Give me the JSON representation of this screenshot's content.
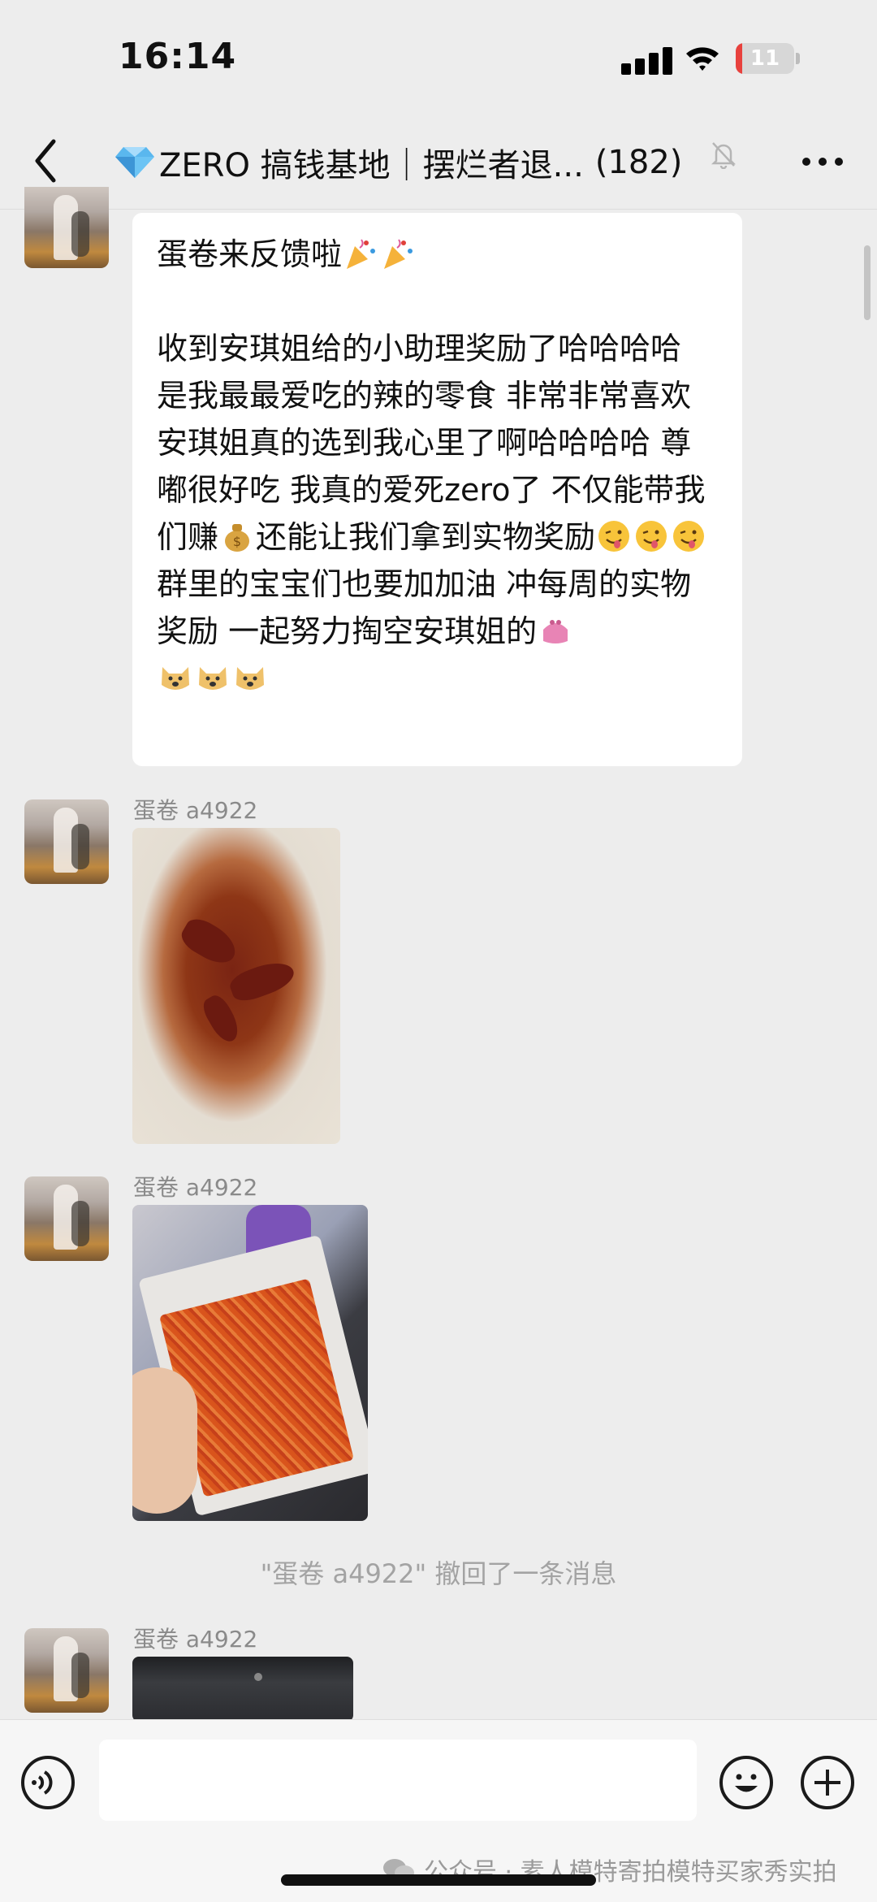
{
  "status_bar": {
    "time": "16:14",
    "battery_level": "11",
    "battery_fraction": 0.11
  },
  "header": {
    "title": "ZERO 搞钱基地｜摆烂者退...",
    "member_count": "(182)",
    "icons": [
      "back-chevron-icon",
      "diamond-icon",
      "muted-bell-icon",
      "more-dots-icon"
    ]
  },
  "messages": [
    {
      "type": "text",
      "lines": [
        "蛋卷来反馈啦",
        "",
        "收到安琪姐给的小助理奖励了哈哈哈哈  是我最最爱吃的辣的零食 非常非常喜欢  安琪姐真的选到我心里了啊哈哈哈哈 尊嘟很好吃 我真的爱死zero了 不仅能带我们赚",
        "还能让我们拿到实物奖励",
        "群里的宝宝们也要加加油 冲每周的实物奖励 一起努力掏空安琪姐的"
      ],
      "emojis": [
        "party-popper",
        "party-popper",
        "money-bag",
        "winking-tongue-face",
        "winking-tongue-face",
        "winking-tongue-face",
        "purse",
        "doge-face",
        "doge-face",
        "doge-face"
      ]
    },
    {
      "type": "image",
      "sender": "蛋卷 a4922",
      "subject": "spicy-snack-in-bowl"
    },
    {
      "type": "image",
      "sender": "蛋卷 a4922",
      "subject": "spicy-snack-package"
    },
    {
      "type": "system",
      "text": "\"蛋卷 a4922\" 撤回了一条消息"
    },
    {
      "type": "image",
      "sender": "蛋卷 a4922",
      "subject": "dark-screen-photo"
    }
  ],
  "input_bar": {
    "value": "",
    "icons": [
      "voice-icon",
      "emoji-icon",
      "plus-icon"
    ]
  },
  "watermark": "公众号 · 素人模特寄拍模特买家秀实拍",
  "colors": {
    "background": "#ededed",
    "bubble": "#ffffff",
    "battery_low": "#e8413d",
    "meta_text": "#8a8a8a"
  }
}
